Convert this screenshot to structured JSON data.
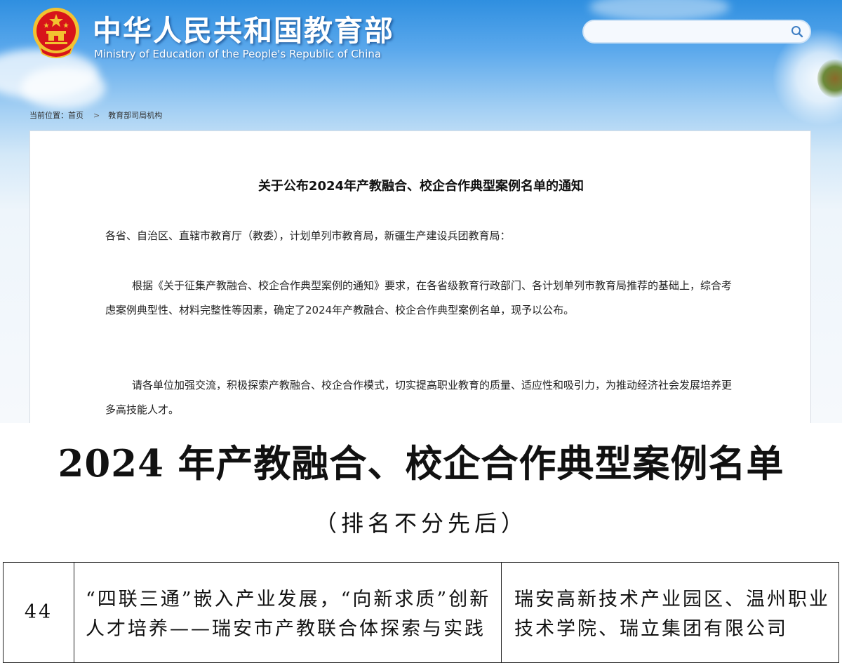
{
  "header": {
    "title_cn": "中华人民共和国教育部",
    "title_en": "Ministry of Education of the People's Republic of China"
  },
  "search": {
    "placeholder": ""
  },
  "breadcrumb": {
    "prefix": "当前位置：",
    "home": "首页",
    "separator": ">",
    "section": "教育部司局机构"
  },
  "notice": {
    "title": "关于公布2024年产教融合、校企合作典型案例名单的通知",
    "salutation": "各省、自治区、直辖市教育厅（教委），计划单列市教育局，新疆生产建设兵团教育局：",
    "paragraph1": "根据《关于征集产教融合、校企合作典型案例的通知》要求，在各省级教育行政部门、各计划单列市教育局推荐的基础上，综合考虑案例典型性、材料完整性等因素，确定了2024年产教融合、校企合作典型案例名单，现予以公布。",
    "paragraph2": "请各单位加强交流，积极探索产教融合、校企合作模式，切实提高职业教育的质量、适应性和吸引力，为推动经济社会发展培养更多高技能人才。"
  },
  "document": {
    "title": "2024 年产教融合、校企合作典型案例名单",
    "subtitle": "（排名不分先后）",
    "rows": [
      {
        "number": "44",
        "case_name": "“四联三通”嵌入产业发展，“向新求质”创新人才培养——瑞安市产教联合体探索与实践",
        "units": "瑞安高新技术产业园区、温州职业技术学院、瑞立集团有限公司"
      }
    ]
  },
  "colors": {
    "sky_top": "#2f8fe0",
    "sky_mid": "#9fcdf3",
    "content_bg": "#ffffff",
    "emblem_red": "#d7141a",
    "emblem_gold": "#f2c230",
    "text_dark": "#111111"
  },
  "icons": [
    "national-emblem-icon",
    "search-icon"
  ]
}
